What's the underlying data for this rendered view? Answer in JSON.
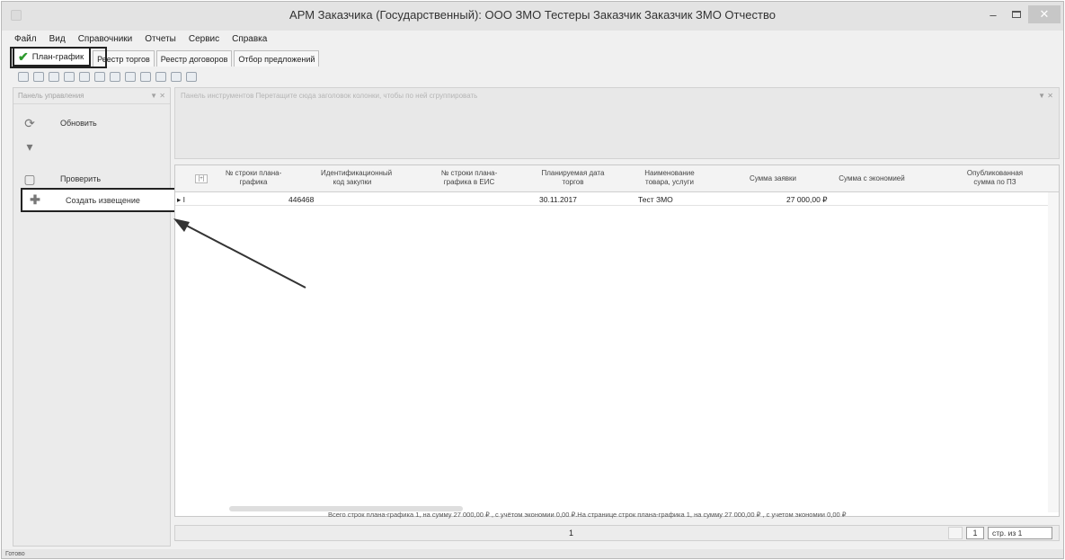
{
  "window": {
    "title": "АРМ Заказчика (Государственный): ООО ЗМО Тестеры Заказчик  Заказчик ЗМО Отчество",
    "minimize_label": "–",
    "close_label": "✕"
  },
  "menu": [
    "Файл",
    "Вид",
    "Справочники",
    "Отчеты",
    "Сервис",
    "Справка"
  ],
  "tabs": [
    {
      "label": "План-график",
      "active": true
    },
    {
      "label": "Реестр торгов",
      "active": false
    },
    {
      "label": "Реестр договоров",
      "active": false
    },
    {
      "label": "Отбор предложений",
      "active": false
    }
  ],
  "left_panel": {
    "header": "Панель управления",
    "refresh_label": "Обновить",
    "check_label": "Проверить",
    "create_label": "Создать извещение"
  },
  "hint_panel": {
    "text": "Панель инструментов  Перетащите сюда заголовок колонки, чтобы по ней сгруппировать"
  },
  "grid": {
    "corner_label": "[+]",
    "columns": [
      "№ строки плана-графика",
      "Идентификационный код закупки",
      "№ строки плана-графика в ЕИС",
      "Планируемая дата торгов",
      "Наименование товара, услуги",
      "Сумма заявки",
      "Сумма с экономией",
      "Опубликованная сумма по ПЗ"
    ],
    "rows": [
      {
        "marker": "▸ I",
        "line_no": "446468",
        "ikz": "",
        "eis_line": "",
        "planned_date": "30.11.2017",
        "name": "Тест ЗМО",
        "amount": "27 000,00 ₽",
        "amount_econ": "",
        "published": ""
      }
    ],
    "totals_text": "Всего строк плана-графика 1, на сумму 27 000,00 ₽ , с учётом экономии 0,00 ₽.На странице строк плана-графика 1, на сумму 27 000,00 ₽ , с учетом экономии 0,00 ₽"
  },
  "pager": {
    "page_number": "1",
    "current_page": "1",
    "of_pages": "стр. из 1"
  },
  "status": "Готово",
  "colors": {
    "highlight_border": "#222222",
    "check_accent": "#2e9a2e"
  },
  "icons": [
    "app-icon",
    "check-icon",
    "refresh-icon",
    "filter-icon",
    "check-doc-icon",
    "plus-icon"
  ]
}
